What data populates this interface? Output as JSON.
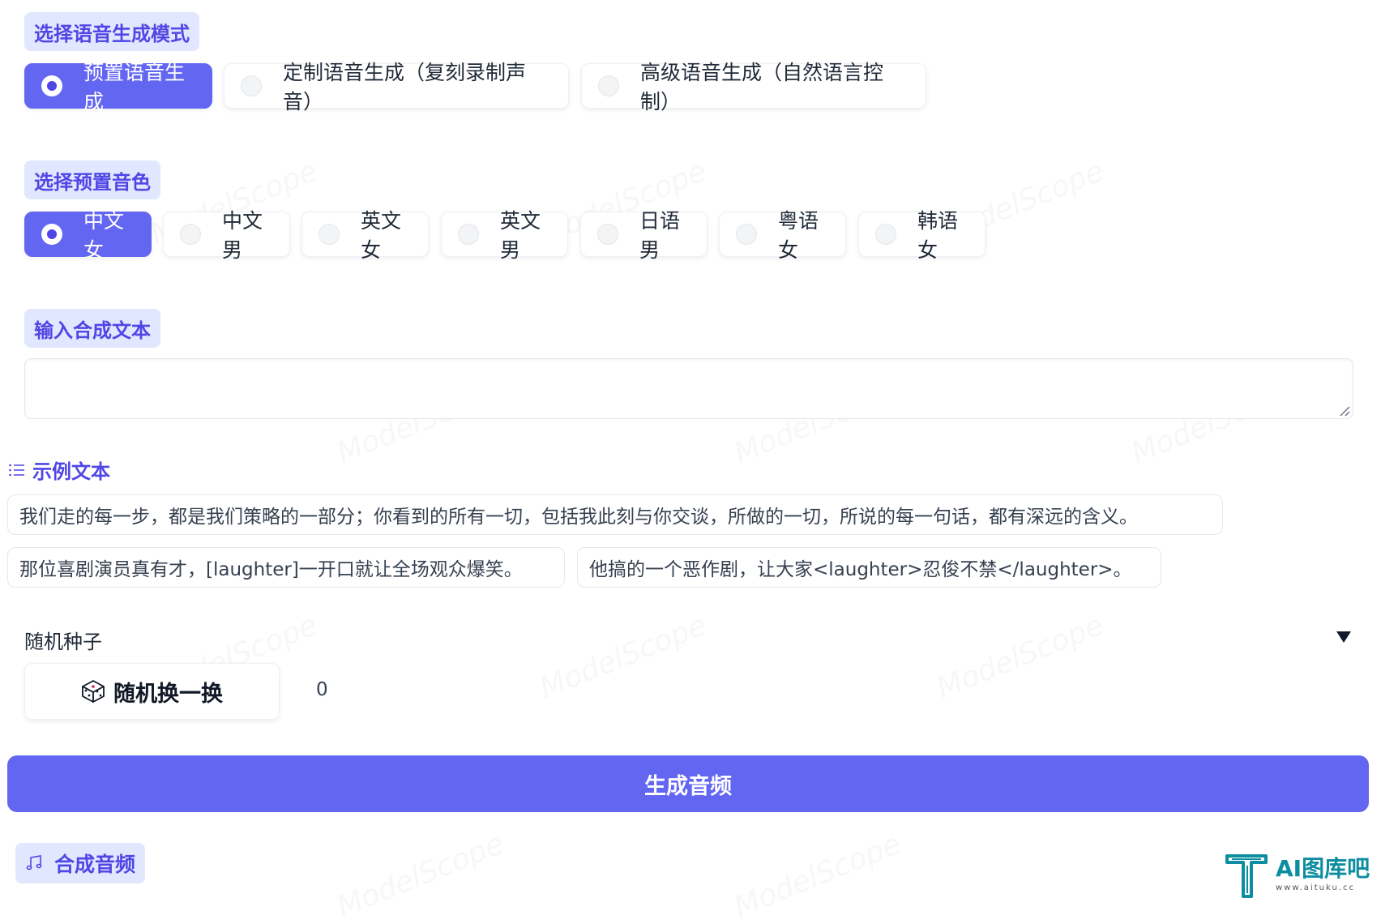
{
  "mode_section": {
    "label": "选择语音生成模式",
    "options": [
      "预置语音生成",
      "定制语音生成（复刻录制声音）",
      "高级语音生成（自然语言控制）"
    ],
    "selected_index": 0
  },
  "voice_section": {
    "label": "选择预置音色",
    "options": [
      "中文女",
      "中文男",
      "英文女",
      "英文男",
      "日语男",
      "粤语女",
      "韩语女"
    ],
    "selected_index": 0
  },
  "text_section": {
    "label": "输入合成文本",
    "value": "",
    "placeholder": ""
  },
  "examples_section": {
    "label": "示例文本",
    "items": [
      "我们走的每一步，都是我们策略的一部分；你看到的所有一切，包括我此刻与你交谈，所做的一切，所说的每一句话，都有深远的含义。",
      "那位喜剧演员真有才，[laughter]一开口就让全场观众爆笑。",
      "他搞的一个恶作剧，让大家<laughter>忍俊不禁</laughter>。"
    ]
  },
  "seed_section": {
    "label": "随机种子",
    "dice_button_label": "随机换一换",
    "value": "0"
  },
  "generate_button_label": "生成音频",
  "output_section": {
    "label": "合成音频"
  },
  "watermark": {
    "text": "ModelScope"
  },
  "brand": {
    "title": "AI图库吧",
    "subtitle": "www.aituku.cc"
  },
  "colors": {
    "accent": "#6366f1",
    "chip_bg": "#e0e7ff",
    "chip_text": "#4f46e5",
    "brand": "#0d8ea0"
  },
  "icons": {
    "examples": "list-icon",
    "seed_toggle": "triangle-down-icon",
    "dice": "dice-icon",
    "audio": "music-note-icon"
  }
}
